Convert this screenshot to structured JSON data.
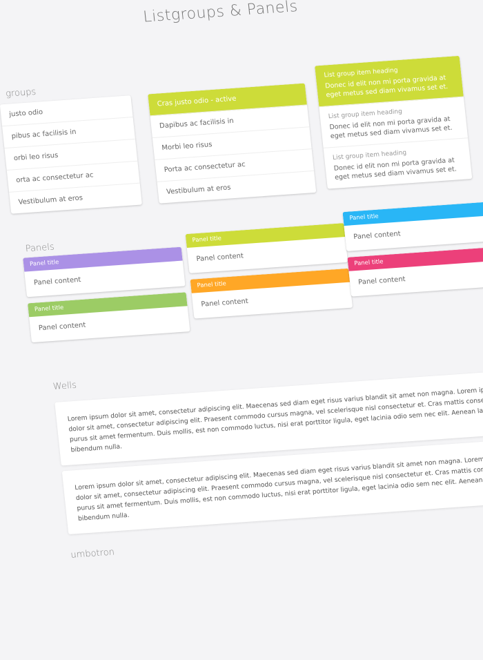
{
  "title": "Listgroups & Panels",
  "sections": {
    "listgroups": "groups",
    "panels": "Panels",
    "wells": "Wells",
    "jumbotron": "umbotron"
  },
  "listgroup_1": {
    "items": [
      "justo odio",
      "pibus ac facilisis in",
      "orbi leo risus",
      "orta ac consectetur ac",
      "Vestibulum at eros"
    ]
  },
  "listgroup_2": {
    "active": "Cras justo odio - active",
    "items": [
      "Dapibus ac facilisis in",
      "Morbi leo risus",
      "Porta ac consectetur ac",
      "Vestibulum at eros"
    ]
  },
  "listgroup_3": {
    "items": [
      {
        "heading": "List group item heading",
        "text": "Donec id elit non mi porta gravida at eget metus sed diam vivamus set et."
      },
      {
        "heading": "List group item heading",
        "text": "Donec id elit non mi porta gravida at eget metus sed diam vivamus set et."
      },
      {
        "heading": "List group item heading",
        "text": "Donec id elit non mi porta gravida at eget metus sed diam vivamus set et."
      }
    ]
  },
  "panels": [
    {
      "title": "Panel title",
      "content": "Panel content",
      "color": "#ab91e6"
    },
    {
      "title": "Panel title",
      "content": "Panel content",
      "color": "#9ccc65"
    },
    {
      "title": "Panel title",
      "content": "Panel content",
      "color": "#cddc39"
    },
    {
      "title": "Panel title",
      "content": "Panel content",
      "color": "#ffa726"
    },
    {
      "title": "Panel title",
      "content": "Panel content",
      "color": "#29b6f6"
    },
    {
      "title": "Panel title",
      "content": "Panel content",
      "color": "#ec407a"
    }
  ],
  "wells": [
    "Lorem ipsum dolor sit amet, consectetur adipiscing elit. Maecenas sed diam eget risus varius blandit sit amet non magna. Lorem ipsum dolor sit amet, consectetur adipiscing elit. Praesent commodo cursus magna, vel scelerisque nisl consectetur et. Cras mattis consectetur purus sit amet fermentum. Duis mollis, est non commodo luctus, nisi erat porttitor ligula, eget lacinia odio sem nec elit. Aenean lacinia bibendum nulla.",
    "Lorem ipsum dolor sit amet, consectetur adipiscing elit. Maecenas sed diam eget risus varius blandit sit amet non magna. Lorem ipsum dolor sit amet, consectetur adipiscing elit. Praesent commodo cursus magna, vel scelerisque nisl consectetur et. Cras mattis consectetur purus sit amet fermentum. Duis mollis, est non commodo luctus, nisi erat porttitor ligula, eget lacinia odio sem nec elit. Aenean lacinia bibendum nulla."
  ]
}
